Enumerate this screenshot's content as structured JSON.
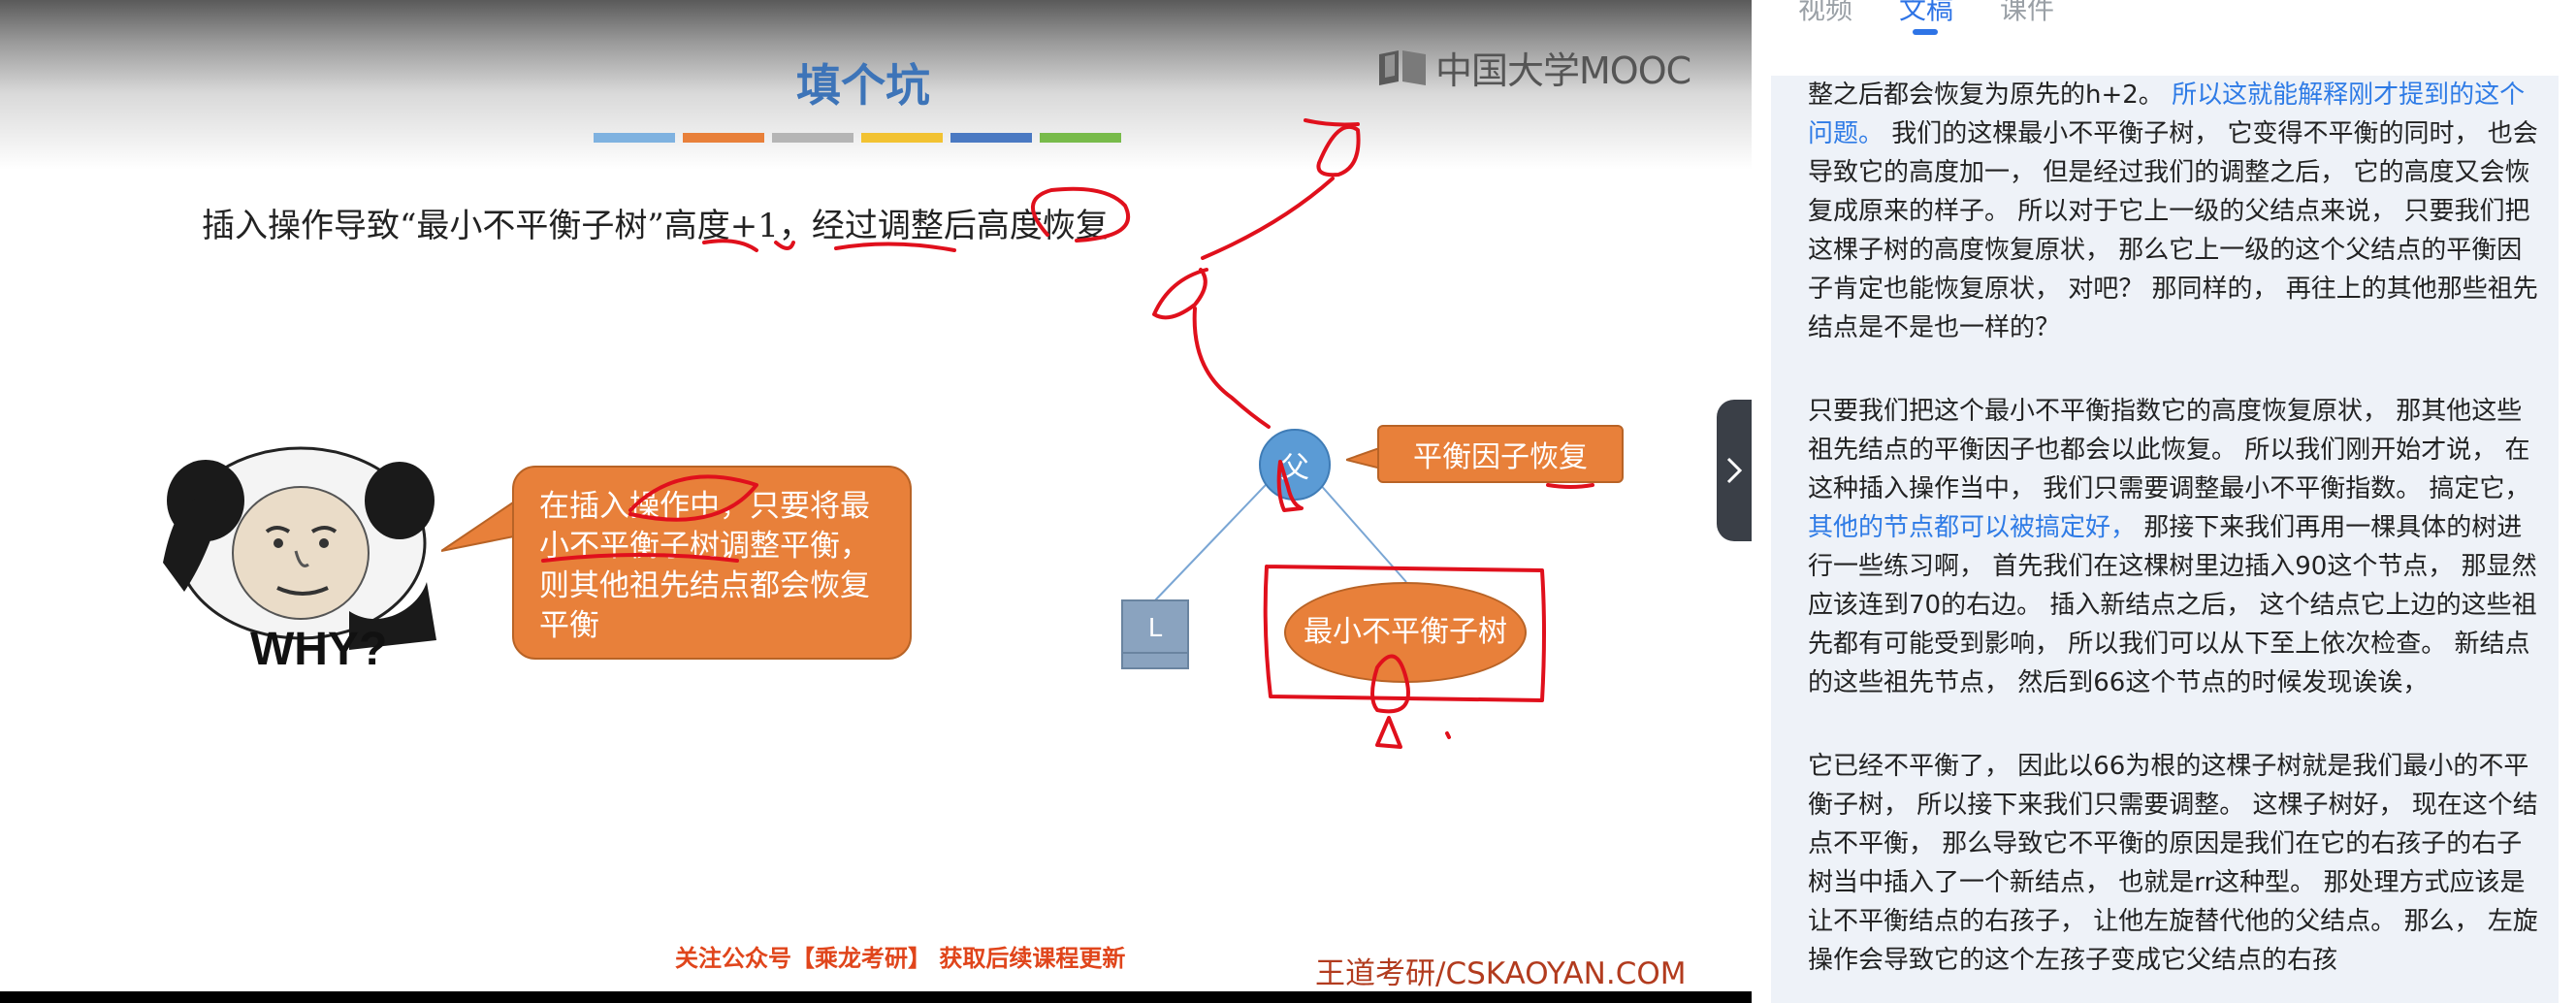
{
  "slide": {
    "title": "填个坑",
    "logo_text": "中国大学MOOC",
    "text_line": "插入操作导致“最小不平衡子树”高度+1，经过调整后高度恢复",
    "meme_caption": "WHY?",
    "bubble_text": "在插入操作中，只要将最小不平衡子树调整平衡，则其他祖先结点都会恢复平衡",
    "node_father": "父",
    "callout": "平衡因子恢复",
    "node_l": "L",
    "subtree": "最小不平衡子树",
    "footer_promo": "关注公众号【乘龙考研】 获取后续课程更新",
    "footer_brand": "王道考研/CSKAOYAN.COM",
    "bar_colors": [
      "#7fb2e0",
      "#e8803a",
      "#b5b5b5",
      "#f2c232",
      "#4a79c2",
      "#78bb4a"
    ],
    "ink_color": "#e0101c"
  },
  "tabs": [
    {
      "label": "视频",
      "active": false
    },
    {
      "label": "文稿",
      "active": true
    },
    {
      "label": "课件",
      "active": false
    }
  ],
  "transcript": {
    "p1": {
      "a": "整之后都会恢复为原先的h+2。",
      "b": "所以这就能解释刚才提到的这个问题。",
      "c": "我们的这棵最小不平衡子树， 它变得不平衡的同时， 也会导致它的高度加一， 但是经过我们的调整之后， 它的高度又会恢复成原来的样子。 所以对于它上一级的父结点来说， 只要我们把这棵子树的高度恢复原状， 那么它上一级的这个父结点的平衡因子肯定也能恢复原状， 对吧？ 那同样的， 再往上的其他那些祖先结点是不是也一样的？"
    },
    "p2": {
      "a": "只要我们把这个最小不平衡指数它的高度恢复原状， 那其他这些祖先结点的平衡因子也都会以此恢复。 所以我们刚开始才说， 在这种插入操作当中， 我们只需要调整最小不平衡指数。 搞定它，",
      "b": "其他的节点都可以被搞定好，",
      "c": "那接下来我们再用一棵具体的树进行一些练习啊， 首先我们在这棵树里边插入90这个节点， 那显然应该连到70的右边。 插入新结点之后， 这个结点它上边的这些祖先都有可能受到影响， 所以我们可以从下至上依次检查。 新结点的这些祖先节点， 然后到66这个节点的时候发现诶诶，"
    },
    "p3": {
      "a": "它已经不平衡了， 因此以66为根的这棵子树就是我们最小的不平衡子树， 所以接下来我们只需要调整。 这棵子树好， 现在这个结点不平衡， 那么导致它不平衡的原因是我们在它的右孩子的右子树当中插入了一个新结点， 也就是rr这种型。 那处理方式应该是让不平衡结点的右孩子， 让他左旋替代他的父结点。 那么， 左旋操作会导致它的这个左孩子变成它父结点的右孩"
    }
  }
}
